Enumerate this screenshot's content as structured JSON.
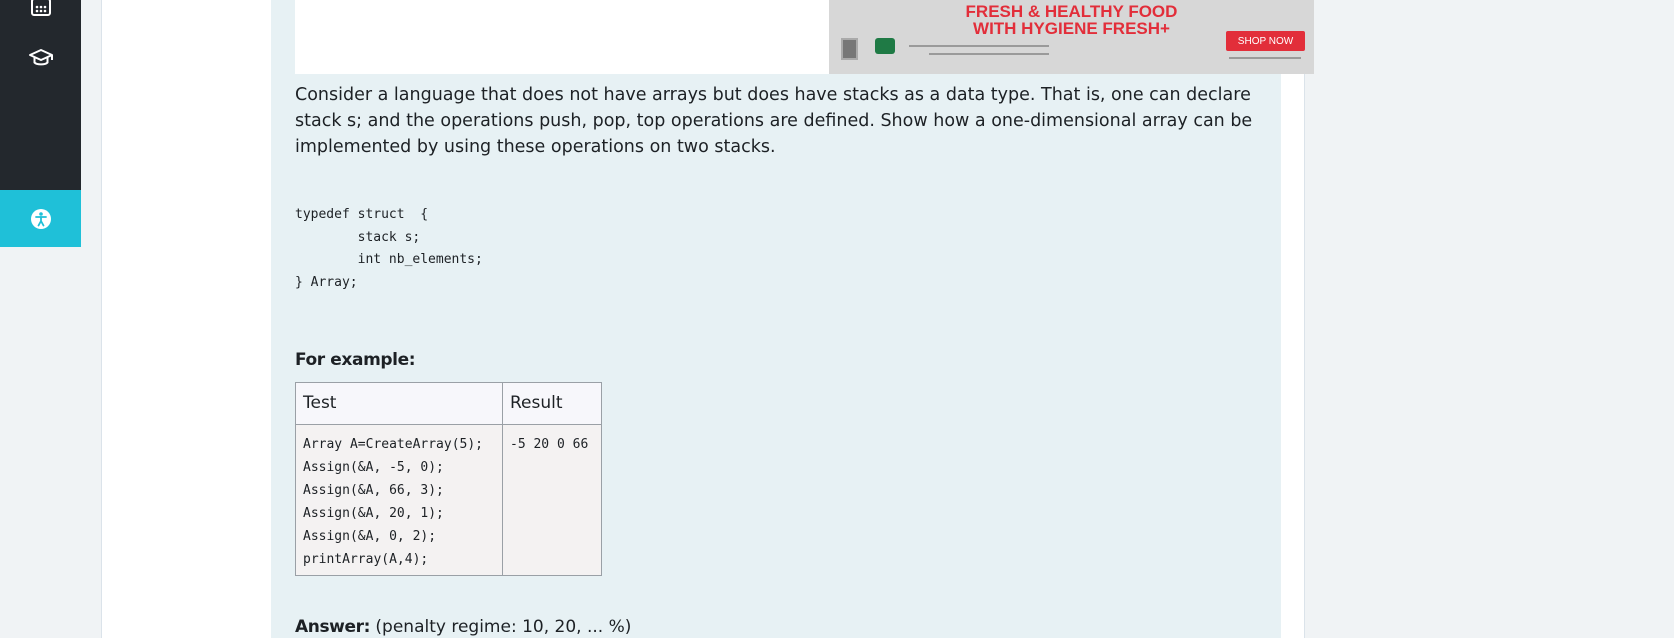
{
  "sidebar": {
    "items": [
      {
        "name": "calendar",
        "icon": "calendar-icon"
      },
      {
        "name": "courses",
        "icon": "graduation-cap-icon"
      }
    ],
    "accessibility_icon": "accessibility-icon",
    "accent_color": "#1fc0d8"
  },
  "ad": {
    "line1": "FRESH & HEALTHY FOOD",
    "line2": "WITH HYGIENE FRESH+",
    "button": "SHOP NOW"
  },
  "question": {
    "text": "Consider a language that does not have arrays but does have stacks as a data type. That is, one can declare stack s; and the operations push, pop, top operations are defined. Show how a one-dimensional array can be implemented by using these operations on two stacks.",
    "code": "typedef struct  {\n        stack s;\n        int nb_elements;\n} Array;",
    "example_label": "For example:",
    "table": {
      "headers": [
        "Test",
        "Result"
      ],
      "rows": [
        {
          "test": "Array A=CreateArray(5);\nAssign(&A, -5, 0);\nAssign(&A, 66, 3);\nAssign(&A, 20, 1);\nAssign(&A, 0, 2);\nprintArray(A,4);",
          "result": "-5 20 0 66"
        }
      ]
    },
    "answer_label": "Answer:",
    "penalty": "(penalty regime: 10, 20, ... %)"
  }
}
